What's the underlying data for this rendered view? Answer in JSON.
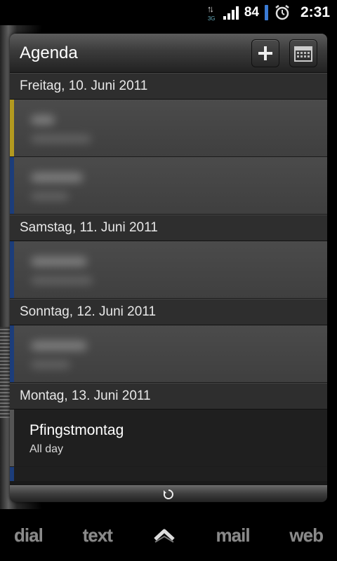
{
  "status_bar": {
    "network_type": "3G",
    "battery_level": "84",
    "time": "2:31",
    "icons": [
      "network-3g-icon",
      "signal-icon",
      "battery-icon",
      "alarm-icon"
    ]
  },
  "widget": {
    "title": "Agenda",
    "add_button_icon": "plus-icon",
    "calendar_button_icon": "calendar-icon",
    "days": [
      {
        "label": "Freitag, 10. Juni 2011"
      },
      {
        "label": "Samstag, 11. Juni 2011"
      },
      {
        "label": "Sonntag, 12. Juni 2011"
      },
      {
        "label": "Montag, 13. Juni 2011"
      }
    ],
    "visible_event": {
      "title": "Pfingstmontag",
      "time": "All day"
    },
    "event_colors": {
      "yellow": "#b39a1f",
      "blue": "#1c3d7a",
      "gray": "#555555"
    },
    "refresh_icon": "refresh-icon"
  },
  "dock": {
    "items": [
      "dial",
      "text",
      "mail",
      "web"
    ],
    "launcher_icon": "chevron-up-icon"
  }
}
